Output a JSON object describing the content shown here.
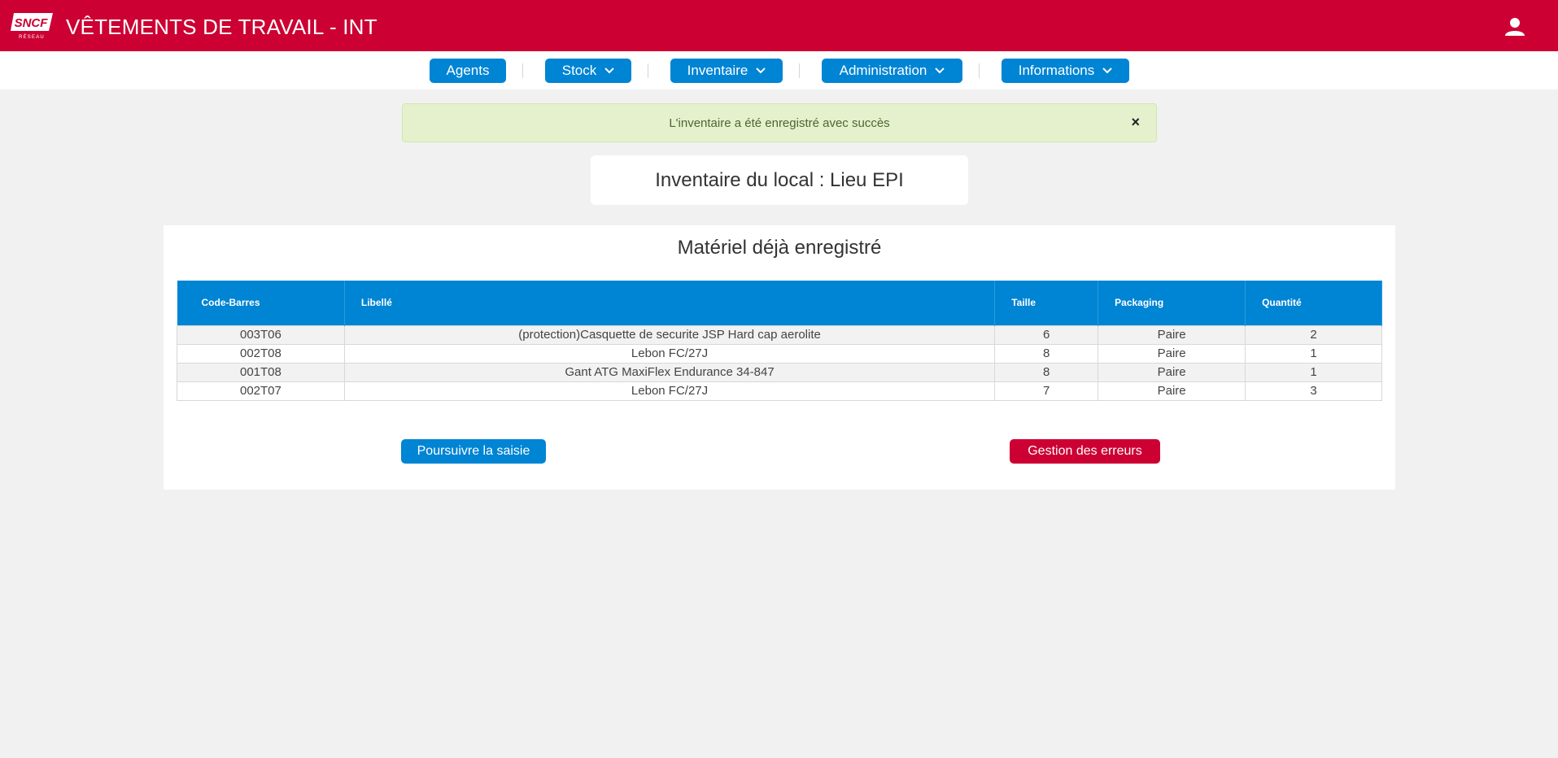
{
  "header": {
    "logo_text": "SNCF",
    "logo_subtext": "RÉSEAU",
    "title": "VÊTEMENTS DE TRAVAIL - INT",
    "user_icon": "user-icon"
  },
  "nav": {
    "items": [
      {
        "label": "Agents",
        "has_dropdown": false
      },
      {
        "label": "Stock",
        "has_dropdown": true
      },
      {
        "label": "Inventaire",
        "has_dropdown": true
      },
      {
        "label": "Administration",
        "has_dropdown": true
      },
      {
        "label": "Informations",
        "has_dropdown": true
      }
    ]
  },
  "alert": {
    "message": "L'inventaire a été enregistré avec succès",
    "close_label": "×"
  },
  "local": {
    "title": "Inventaire du local : Lieu EPI"
  },
  "panel": {
    "title": "Matériel déjà enregistré",
    "columns": [
      "Code-Barres",
      "Libellé",
      "Taille",
      "Packaging",
      "Quantité"
    ],
    "rows": [
      {
        "code": "003T06",
        "libelle": "(protection)Casquette de securite JSP Hard cap aerolite",
        "taille": "6",
        "packaging": "Paire",
        "quantite": "2"
      },
      {
        "code": "002T08",
        "libelle": "Lebon FC/27J",
        "taille": "8",
        "packaging": "Paire",
        "quantite": "1"
      },
      {
        "code": "001T08",
        "libelle": "Gant ATG MaxiFlex Endurance 34-847",
        "taille": "8",
        "packaging": "Paire",
        "quantite": "1"
      },
      {
        "code": "002T07",
        "libelle": "Lebon FC/27J",
        "taille": "7",
        "packaging": "Paire",
        "quantite": "3"
      }
    ],
    "continue_label": "Poursuivre la saisie",
    "errors_label": "Gestion des erreurs"
  },
  "colors": {
    "brand_red": "#cc0033",
    "primary_blue": "#0084d4",
    "success_bg": "#e5f1cd",
    "danger": "#cc0033"
  }
}
